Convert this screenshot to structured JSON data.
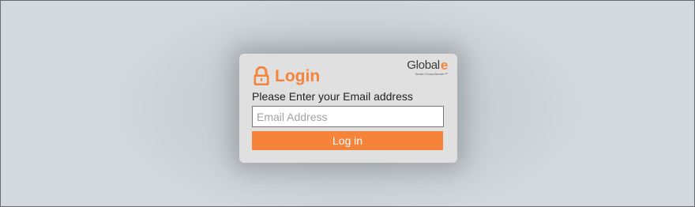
{
  "brand": {
    "name": "Global",
    "name_suffix": "e",
    "tagline": "Smart Cross-Border™"
  },
  "login": {
    "title": "Login",
    "prompt": "Please Enter your Email address",
    "email_placeholder": "Email Address",
    "email_value": "",
    "button_label": "Log in"
  },
  "icons": {
    "lock": "lock-icon"
  },
  "colors": {
    "accent": "#f5843a",
    "background": "#d3d9de",
    "card": "#e0e0e0"
  }
}
